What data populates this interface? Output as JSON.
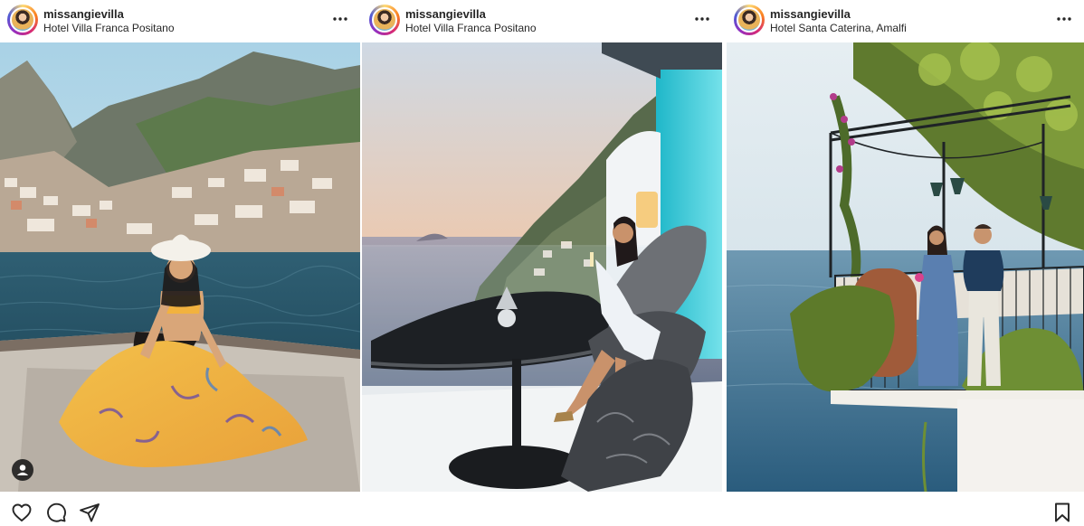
{
  "posts": [
    {
      "username": "missangievilla",
      "location": "Hotel Villa Franca Positano",
      "has_tag_button": true
    },
    {
      "username": "missangievilla",
      "location": "Hotel Villa Franca Positano",
      "has_tag_button": false
    },
    {
      "username": "missangievilla",
      "location": "Hotel Santa Caterina, Amalfi",
      "has_tag_button": false
    }
  ],
  "icons": {
    "more": "more-options-icon",
    "like": "heart-icon",
    "comment": "comment-icon",
    "share": "send-icon",
    "save": "bookmark-icon",
    "tag": "user-tag-icon"
  },
  "colors": {
    "text": "#262626",
    "background": "#ffffff",
    "story_ring": "#d62976"
  }
}
